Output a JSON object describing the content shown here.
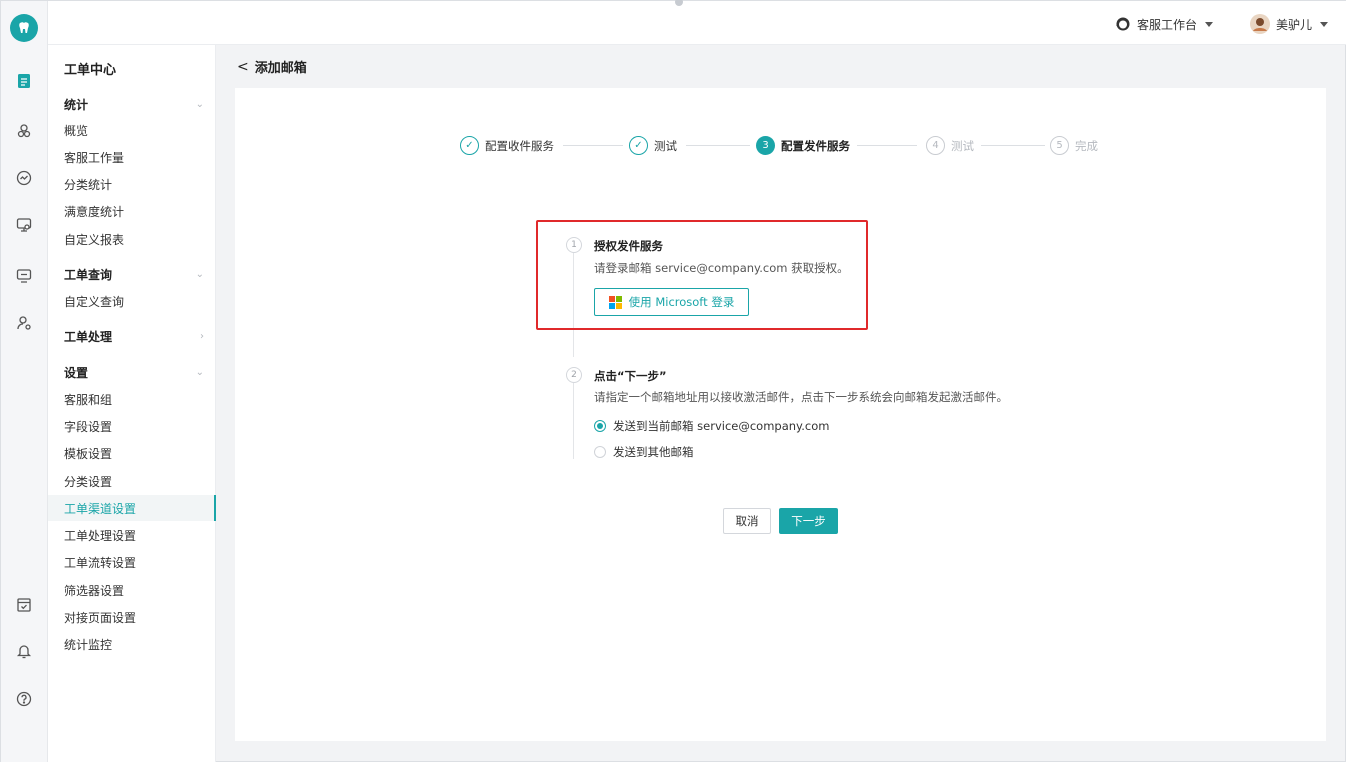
{
  "topbar": {
    "workspace_label": "客服工作台",
    "user_name": "美驴儿"
  },
  "rail": {
    "icons": [
      "logo-icon",
      "ticket-icon",
      "contacts-icon",
      "dashboard-icon",
      "chat-icon",
      "monitor-icon",
      "user-settings-icon",
      "task-icon",
      "bell-icon",
      "help-icon"
    ]
  },
  "sidebar": {
    "title": "工单中心",
    "groups": {
      "stats": {
        "label": "统计",
        "items": [
          "概览",
          "客服工作量",
          "分类统计",
          "满意度统计",
          "自定义报表"
        ]
      },
      "query": {
        "label": "工单查询",
        "items": [
          "自定义查询"
        ]
      },
      "process": {
        "label": "工单处理"
      },
      "settings": {
        "label": "设置",
        "items": [
          "客服和组",
          "字段设置",
          "模板设置",
          "分类设置",
          "工单渠道设置",
          "工单处理设置",
          "工单流转设置",
          "筛选器设置",
          "对接页面设置",
          "统计监控"
        ]
      }
    }
  },
  "breadcrumb": {
    "back_label": "添加邮箱"
  },
  "steps": [
    {
      "num": "1",
      "label": "配置收件服务",
      "state": "done"
    },
    {
      "num": "2",
      "label": "测试",
      "state": "done"
    },
    {
      "num": "3",
      "label": "配置发件服务",
      "state": "current"
    },
    {
      "num": "4",
      "label": "测试",
      "state": "todo"
    },
    {
      "num": "5",
      "label": "完成",
      "state": "todo"
    }
  ],
  "substep1": {
    "num": "1",
    "title": "授权发件服务",
    "desc": "请登录邮箱 service@company.com 获取授权。",
    "button": "使用 Microsoft 登录"
  },
  "substep2": {
    "num": "2",
    "title": "点击“下一步”",
    "desc": "请指定一个邮箱地址用以接收激活邮件，点击下一步系统会向邮箱发起激活邮件。",
    "options": [
      {
        "label": "发送到当前邮箱 service@company.com",
        "checked": true
      },
      {
        "label": "发送到其他邮箱",
        "checked": false
      }
    ]
  },
  "actions": {
    "cancel": "取消",
    "next": "下一步"
  },
  "colors": {
    "accent": "#1aa5a8",
    "highlight": "#e0292b"
  }
}
